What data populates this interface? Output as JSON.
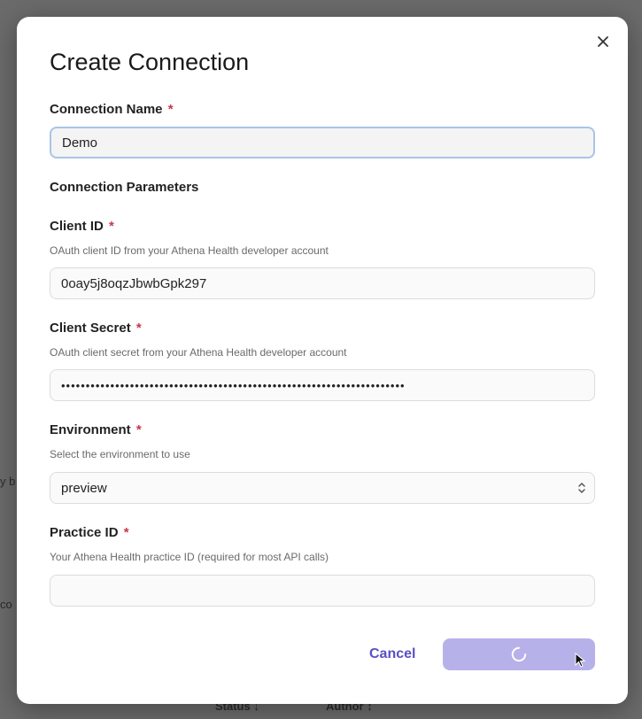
{
  "background": {
    "left_fragment_1": "y b",
    "left_fragment_2": "co",
    "status_header": "Status ↓",
    "author_header": "Author ↕"
  },
  "modal": {
    "title": "Create Connection",
    "connection_name": {
      "label": "Connection Name",
      "required_mark": "*",
      "value": "Demo"
    },
    "section_title": "Connection Parameters",
    "client_id": {
      "label": "Client ID",
      "required_mark": "*",
      "help": "OAuth client ID from your Athena Health developer account",
      "value": "0oay5j8oqzJbwbGpk297"
    },
    "client_secret": {
      "label": "Client Secret",
      "required_mark": "*",
      "help": "OAuth client secret from your Athena Health developer account",
      "value": "••••••••••••••••••••••••••••••••••••••••••••••••••••••••••••••••••••••"
    },
    "environment": {
      "label": "Environment",
      "required_mark": "*",
      "help": "Select the environment to use",
      "value": "preview"
    },
    "practice_id": {
      "label": "Practice ID",
      "required_mark": "*",
      "help": "Your Athena Health practice ID (required for most API calls)",
      "value": ""
    },
    "cancel_label": "Cancel"
  },
  "colors": {
    "accent": "#5a4fc4",
    "submit_loading": "#b7b1ea",
    "required": "#c8374a"
  },
  "icons": {
    "close": "close-icon",
    "select": "chevron-up-down-icon",
    "loading": "spinner-icon",
    "cursor": "mouse-pointer-icon"
  }
}
